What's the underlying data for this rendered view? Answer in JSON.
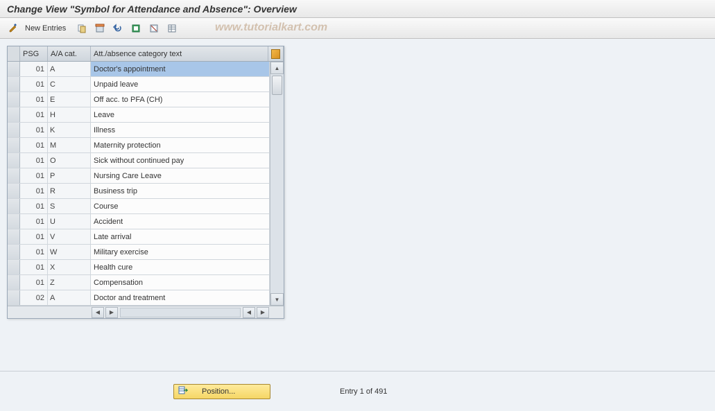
{
  "title": "Change View \"Symbol for Attendance and Absence\": Overview",
  "toolbar": {
    "new_entries_label": "New Entries"
  },
  "watermark": "www.tutorialkart.com",
  "table": {
    "columns": {
      "psg": "PSG",
      "cat": "A/A cat.",
      "text": "Att./absence category text"
    },
    "rows": [
      {
        "psg": "01",
        "cat": "A",
        "text": "Doctor's appointment",
        "selected": true
      },
      {
        "psg": "01",
        "cat": "C",
        "text": "Unpaid leave"
      },
      {
        "psg": "01",
        "cat": "E",
        "text": "Off acc. to PFA (CH)"
      },
      {
        "psg": "01",
        "cat": "H",
        "text": "Leave"
      },
      {
        "psg": "01",
        "cat": "K",
        "text": "Illness"
      },
      {
        "psg": "01",
        "cat": "M",
        "text": "Maternity protection"
      },
      {
        "psg": "01",
        "cat": "O",
        "text": "Sick without continued pay"
      },
      {
        "psg": "01",
        "cat": "P",
        "text": "Nursing Care Leave"
      },
      {
        "psg": "01",
        "cat": "R",
        "text": "Business trip"
      },
      {
        "psg": "01",
        "cat": "S",
        "text": "Course"
      },
      {
        "psg": "01",
        "cat": "U",
        "text": "Accident"
      },
      {
        "psg": "01",
        "cat": "V",
        "text": "Late arrival"
      },
      {
        "psg": "01",
        "cat": "W",
        "text": "Military exercise"
      },
      {
        "psg": "01",
        "cat": "X",
        "text": "Health cure"
      },
      {
        "psg": "01",
        "cat": "Z",
        "text": "Compensation"
      },
      {
        "psg": "02",
        "cat": "A",
        "text": "Doctor and treatment"
      }
    ]
  },
  "footer": {
    "position_label": "Position...",
    "entry_status": "Entry 1 of 491"
  }
}
